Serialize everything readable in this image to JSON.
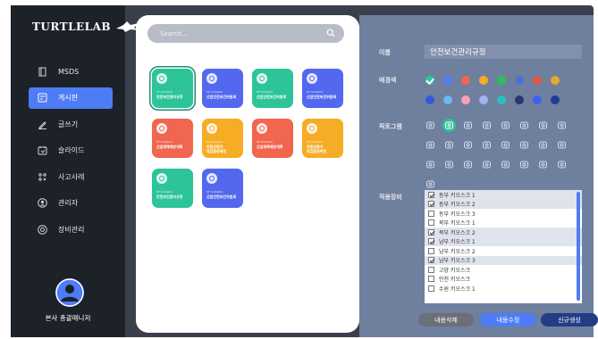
{
  "app": {
    "logo_text": "TURTLELAB"
  },
  "sidebar": {
    "items": [
      {
        "label": "MSDS",
        "icon": "book-icon",
        "active": false
      },
      {
        "label": "게시판",
        "icon": "board-icon",
        "active": true
      },
      {
        "label": "글쓰기",
        "icon": "pencil-icon",
        "active": false
      },
      {
        "label": "슬라이드",
        "icon": "slide-icon",
        "active": false
      },
      {
        "label": "사고사례",
        "icon": "nodes-icon",
        "active": false
      },
      {
        "label": "관리자",
        "icon": "user-circle-icon",
        "active": false
      },
      {
        "label": "장비관리",
        "icon": "gear-circle-icon",
        "active": false
      }
    ],
    "user_name": "본사 총괄매니저"
  },
  "search": {
    "placeholder": "Search..."
  },
  "cards": [
    {
      "color": "#2dc49a",
      "sub": "SF Contents",
      "title": "안전보건관리규정",
      "title2": "",
      "selected": true
    },
    {
      "color": "#5268ef",
      "sub": "SF Contents",
      "title": "산업안전보건위원회",
      "title2": "",
      "selected": false
    },
    {
      "color": "#2dc49a",
      "sub": "SF Contents",
      "title": "산업안전보건위원회",
      "title2": "",
      "selected": false
    },
    {
      "color": "#5268ef",
      "sub": "SF Contents",
      "title": "산업안전보건위원회",
      "title2": "",
      "selected": false
    },
    {
      "color": "#f1664f",
      "sub": "SF Contents",
      "title": "산업재해예방계획",
      "title2": "",
      "selected": false
    },
    {
      "color": "#f7ac26",
      "sub": "SF Contents",
      "title": "위험성평가",
      "title2": "작업환경측정",
      "selected": false
    },
    {
      "color": "#f1664f",
      "sub": "SF Contents",
      "title": "산업재해예방계획",
      "title2": "",
      "selected": false
    },
    {
      "color": "#f7ac26",
      "sub": "SF Contents",
      "title": "위험성평가",
      "title2": "작업환경측정",
      "selected": false
    },
    {
      "color": "#2dc49a",
      "sub": "SF Contents",
      "title": "안전보건관리규정",
      "title2": "",
      "selected": false
    },
    {
      "color": "#5268ef",
      "sub": "SF Contents",
      "title": "산업안전보건위원회",
      "title2": "",
      "selected": false
    }
  ],
  "detail": {
    "name_label": "이름",
    "name_value": "안전보건관리규정",
    "bg_label": "배경색",
    "colors_row1": [
      "#2dc49a",
      "#4e7cf4",
      "#f1664f",
      "#f7ac26",
      "#2dbf5a",
      "#4e6fd4",
      "#e0584a",
      "#e6a830"
    ],
    "colors_row2": [
      "#3558d8",
      "#6cb8f7",
      "#f7a2b8",
      "#9fb4f2",
      "#26c2c2",
      "#2a3670",
      "#3a64f0",
      "#1f3c96"
    ],
    "selected_color_index": 0,
    "picto_label": "픽토그램",
    "picto_icons": [
      "hand-icon",
      "tag-icon",
      "ear-icon",
      "person-icon",
      "helmet-icon",
      "mask-icon",
      "tree-icon",
      "warning-icon",
      "building-icon",
      "machine-icon",
      "car-icon",
      "chat-icon",
      "truck-icon",
      "bus-icon",
      "house-icon",
      "forklift-icon",
      "worker-icon",
      "crane-icon",
      "fire-icon",
      "bag-icon",
      "board-icon",
      "box-icon",
      "pc-icon",
      "bike-icon",
      "alarm-icon"
    ],
    "selected_picto_index": 1,
    "equip_label": "적용장비",
    "equipment": [
      {
        "label": "동부 키오스크 1",
        "checked": true
      },
      {
        "label": "동부 키오스크 2",
        "checked": true
      },
      {
        "label": "동부 키오스크 3",
        "checked": false
      },
      {
        "label": "북부 키오스크 1",
        "checked": false
      },
      {
        "label": "북부 키오스크 2",
        "checked": true
      },
      {
        "label": "남부 키오스크 1",
        "checked": true
      },
      {
        "label": "남부 키오스크 2",
        "checked": false
      },
      {
        "label": "남부 키오스크 3",
        "checked": true
      },
      {
        "label": "고양 키오스크",
        "checked": false
      },
      {
        "label": "인천 키오스크",
        "checked": false
      },
      {
        "label": "수원 키오스크 1",
        "checked": false
      }
    ],
    "buttons": {
      "delete": "내용삭제",
      "edit": "내용수정",
      "create": "신규생성"
    }
  }
}
